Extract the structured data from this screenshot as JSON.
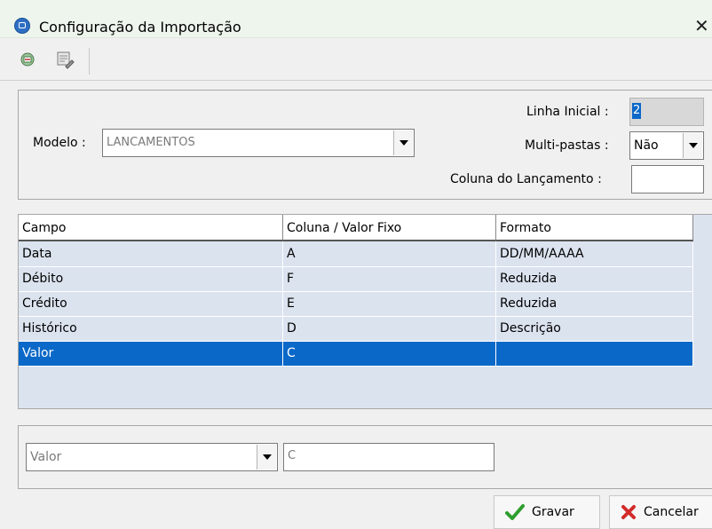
{
  "window": {
    "title": "Configuração da Importação",
    "close_glyph": "✕"
  },
  "toolbar": {
    "icons": [
      "import-settings-icon",
      "edit-form-icon"
    ]
  },
  "header": {
    "modelo_label": "Modelo :",
    "modelo_value": "LANCAMENTOS",
    "linha_inicial_label": "Linha Inicial :",
    "linha_inicial_value": "2",
    "multi_pastas_label": "Multi-pastas :",
    "multi_pastas_value": "Não",
    "coluna_lancamento_label": "Coluna do Lançamento :",
    "coluna_lancamento_value": ""
  },
  "table": {
    "columns": [
      "Campo",
      "Coluna / Valor Fixo",
      "Formato"
    ],
    "rows": [
      [
        "Data",
        "A",
        "DD/MM/AAAA"
      ],
      [
        "Débito",
        "F",
        "Reduzida"
      ],
      [
        "Crédito",
        "E",
        "Reduzida"
      ],
      [
        "Histórico",
        "D",
        "Descrição"
      ],
      [
        "Valor",
        "C",
        ""
      ]
    ],
    "selected_index": 4
  },
  "editor": {
    "field_value": "Valor",
    "column_value": "C"
  },
  "buttons": {
    "save_label": "Gravar",
    "cancel_label": "Cancelar"
  },
  "colors": {
    "selection": "#0a68c8",
    "save_check": "#2e9e2e",
    "cancel_x": "#d22b2b",
    "grid_bg": "#dbe3ef"
  }
}
